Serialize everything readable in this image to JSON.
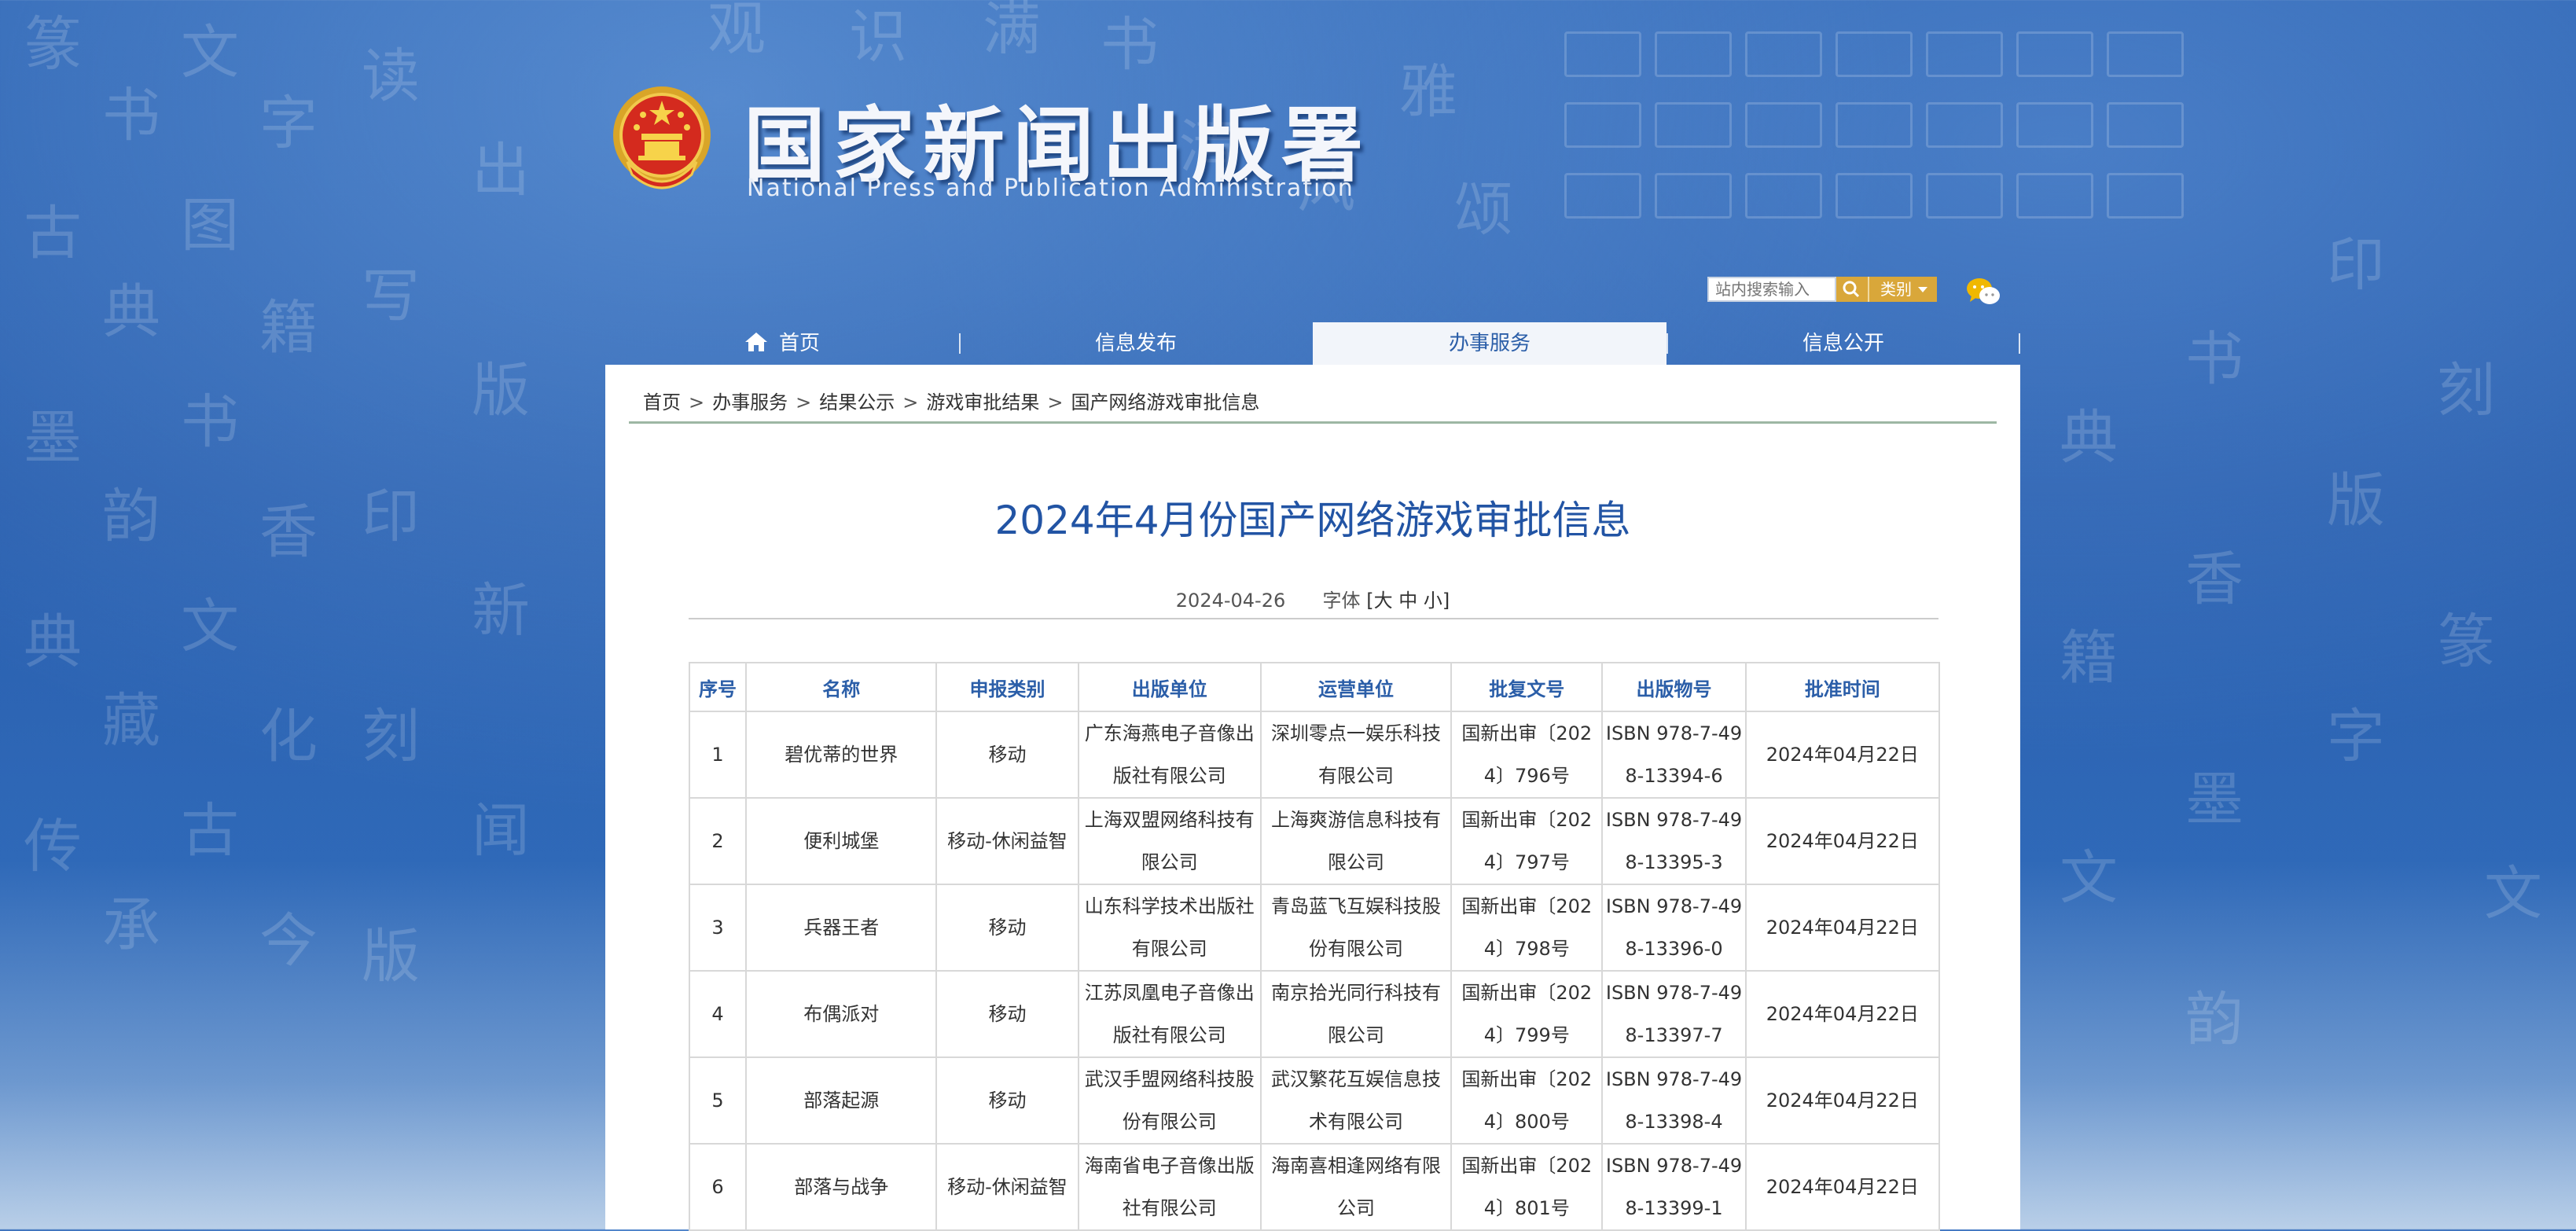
{
  "header": {
    "title_cn": "国家新闻出版署",
    "title_en": "National  Press and Publication Administration"
  },
  "search": {
    "placeholder": "站内搜索输入",
    "category_label": "类别"
  },
  "nav": {
    "items": [
      {
        "label": "首页",
        "icon": "home-icon"
      },
      {
        "label": "信息发布"
      },
      {
        "label": "办事服务",
        "active": true
      },
      {
        "label": "信息公开"
      }
    ]
  },
  "breadcrumb": [
    "首页",
    "办事服务",
    "结果公示",
    "游戏审批结果",
    "国产网络游戏审批信息"
  ],
  "article": {
    "title": "2024年4月份国产网络游戏审批信息",
    "date": "2024-04-26",
    "font_label": "字体",
    "font_sizes": [
      "大",
      "中",
      "小"
    ]
  },
  "table": {
    "headers": [
      "序号",
      "名称",
      "申报类别",
      "出版单位",
      "运营单位",
      "批复文号",
      "出版物号",
      "批准时间"
    ],
    "rows": [
      [
        "1",
        "碧优蒂的世界",
        "移动",
        "广东海燕电子音像出版社有限公司",
        "深圳零点一娱乐科技有限公司",
        "国新出审〔2024〕796号",
        "ISBN 978-7-498-13394-6",
        "2024年04月22日"
      ],
      [
        "2",
        "便利城堡",
        "移动-休闲益智",
        "上海双盟网络科技有限公司",
        "上海爽游信息科技有限公司",
        "国新出审〔2024〕797号",
        "ISBN 978-7-498-13395-3",
        "2024年04月22日"
      ],
      [
        "3",
        "兵器王者",
        "移动",
        "山东科学技术出版社有限公司",
        "青岛蓝飞互娱科技股份有限公司",
        "国新出审〔2024〕798号",
        "ISBN 978-7-498-13396-0",
        "2024年04月22日"
      ],
      [
        "4",
        "布偶派对",
        "移动",
        "江苏凤凰电子音像出版社有限公司",
        "南京拾光同行科技有限公司",
        "国新出审〔2024〕799号",
        "ISBN 978-7-498-13397-7",
        "2024年04月22日"
      ],
      [
        "5",
        "部落起源",
        "移动",
        "武汉手盟网络科技股份有限公司",
        "武汉繁花互娱信息技术有限公司",
        "国新出审〔2024〕800号",
        "ISBN 978-7-498-13398-4",
        "2024年04月22日"
      ],
      [
        "6",
        "部落与战争",
        "移动-休闲益智",
        "海南省电子音像出版社有限公司",
        "海南喜相逢网络有限公司",
        "国新出审〔2024〕801号",
        "ISBN 978-7-498-13399-1",
        "2024年04月22日"
      ]
    ]
  }
}
